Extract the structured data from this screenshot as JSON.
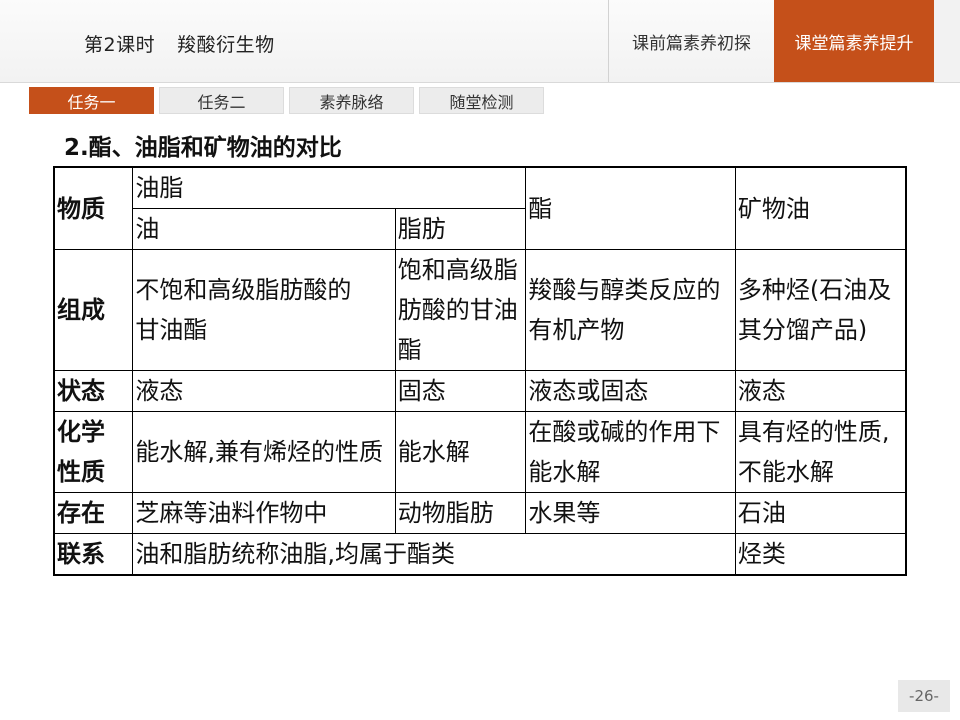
{
  "header": {
    "lesson": "第2课时",
    "topic": "羧酸衍生物",
    "tab_pre": "课前篇素养初探",
    "tab_current": "课堂篇素养提升"
  },
  "subtabs": [
    "任务一",
    "任务二",
    "素养脉络",
    "随堂检测"
  ],
  "section_title": "2.酯、油脂和矿物油的对比",
  "table": {
    "h_substance": "物质",
    "h_fat_group": "油脂",
    "h_ester": "酯",
    "h_mineral": "矿物油",
    "h_oil": "油",
    "h_fat": "脂肪",
    "rows": {
      "composition": {
        "label": "组成",
        "oil": "不饱和高级脂肪酸的甘油酯",
        "fat": "饱和高级脂肪酸的甘油酯",
        "ester": "羧酸与醇类反应的有机产物",
        "mineral": "多种烃(石油及其分馏产品)"
      },
      "state": {
        "label": "状态",
        "oil": "液态",
        "fat": "固态",
        "ester": "液态或固态",
        "mineral": "液态"
      },
      "chem": {
        "label": "化学性质",
        "oil": "能水解,兼有烯烃的性质",
        "fat": "能水解",
        "ester": "在酸或碱的作用下能水解",
        "mineral": "具有烃的性质,不能水解"
      },
      "exist": {
        "label": "存在",
        "oil": "芝麻等油料作物中",
        "fat": "动物脂肪",
        "ester": "水果等",
        "mineral": "石油"
      },
      "relation": {
        "label": "联系",
        "oil_fat_ester": "油和脂肪统称油脂,均属于酯类",
        "mineral": "烃类"
      }
    }
  },
  "page_number": "-26-"
}
